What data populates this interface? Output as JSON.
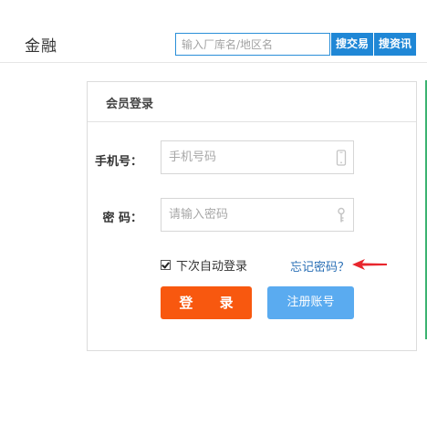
{
  "header": {
    "logo_text": "金融",
    "search_placeholder": "输入厂库名/地区名",
    "search_trade_label": "搜交易",
    "search_news_label": "搜资讯"
  },
  "login": {
    "title": "会员登录",
    "phone_label": "手机号：",
    "phone_placeholder": "手机号码",
    "password_label": "密 码：",
    "password_placeholder": "请输入密码",
    "remember_label": "下次自动登录",
    "remember_checked": true,
    "forgot_label": "忘记密码？",
    "login_button": "登 录",
    "register_button": "注册账号"
  },
  "colors": {
    "accent_blue": "#1f87d6",
    "login_orange": "#f8580f",
    "register_blue": "#5aabf0",
    "link_blue": "#2a6fb5",
    "annotation_red": "#e8262d"
  },
  "icons": {
    "phone_field": "mobile-phone-icon",
    "password_field": "key-icon",
    "annotation": "red-arrow-icon"
  }
}
